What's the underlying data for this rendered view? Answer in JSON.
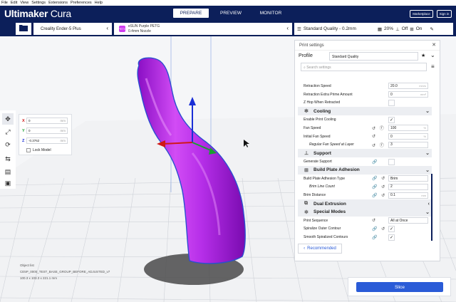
{
  "menu": [
    "File",
    "Edit",
    "View",
    "Settings",
    "Extensions",
    "Preferences",
    "Help"
  ],
  "app": {
    "brand": "Ultimaker",
    "brand_suffix": "Cura"
  },
  "stages": [
    "PREPARE",
    "PREVIEW",
    "MONITOR"
  ],
  "active_stage": "PREPARE",
  "header_buttons": {
    "marketplace": "Marketplace",
    "account": "Sign in"
  },
  "printer": {
    "name": "Creality Ender-5 Plus"
  },
  "material": {
    "swatch_label": "PETG",
    "name": "eSUN Purple PETG",
    "nozzle": "0.4mm Nozzle",
    "color": "#cf3cf0"
  },
  "summary": {
    "quality": "Standard Quality - 0.2mm",
    "infill": "20%",
    "support": "Off",
    "adhesion": "On"
  },
  "move_panel": {
    "x": {
      "label": "X",
      "value": "0",
      "unit": "mm"
    },
    "y": {
      "label": "Y",
      "value": "0",
      "unit": "mm"
    },
    "z": {
      "label": "Z",
      "value": "-0.3762",
      "unit": "mm"
    },
    "lock_model": "Lock Model"
  },
  "object_list": [
    "Object list",
    "CE5P_0000_TEST_BASE_GROUP_BEFORE_ADJUSTED_v7",
    "100.3 x 103.3 x 221.1 mm"
  ],
  "panel": {
    "title": "Print settings",
    "profile_label": "Profile",
    "profile_value": "Standard Quality",
    "search_placeholder": "Search settings",
    "rows": [
      {
        "kind": "field",
        "label": "Retraction Speed",
        "value": "20.0",
        "unit": "mm/s"
      },
      {
        "kind": "field",
        "label": "Retraction Extra Prime Amount",
        "value": "0",
        "unit": "mm³"
      },
      {
        "kind": "check",
        "label": "Z Hop When Retracted",
        "value": ""
      },
      {
        "kind": "category",
        "label": "Cooling",
        "icon": "✻",
        "chevron": "⌄"
      },
      {
        "kind": "check",
        "label": "Enable Print Cooling",
        "value": "✓"
      },
      {
        "kind": "field",
        "label": "Fan Speed",
        "value": "100",
        "unit": "%",
        "icons": "↺ ⓕ"
      },
      {
        "kind": "field",
        "label": "Initial Fan Speed",
        "value": "0",
        "unit": "%",
        "icons": "↺"
      },
      {
        "kind": "field",
        "label": "Regular Fan Speed at Layer",
        "value": "3",
        "unit": "",
        "icons": "↺ ⓕ",
        "indent": true
      },
      {
        "kind": "category",
        "label": "Support",
        "icon": "⊥",
        "chevron": "⌄"
      },
      {
        "kind": "check",
        "label": "Generate Support",
        "value": "",
        "icons": "🔗"
      },
      {
        "kind": "category",
        "label": "Build Plate Adhesion",
        "icon": "⊞",
        "chevron": "⌄"
      },
      {
        "kind": "field",
        "label": "Build Plate Adhesion Type",
        "value": "Brim",
        "unit": "",
        "icons": "🔗 ↺"
      },
      {
        "kind": "field",
        "label": "Brim Line Count",
        "value": "2",
        "unit": "",
        "icons": "🔗 ↺",
        "indent": true
      },
      {
        "kind": "field",
        "label": "Brim Distance",
        "value": "0.1",
        "unit": "mm",
        "icons": "🔗 ↺"
      },
      {
        "kind": "category",
        "label": "Dual Extrusion",
        "icon": "⧉",
        "chevron": "‹"
      },
      {
        "kind": "category",
        "label": "Special Modes",
        "icon": "✲",
        "chevron": "⌄"
      },
      {
        "kind": "field",
        "label": "Print Sequence",
        "value": "All at Once",
        "unit": "",
        "icons": "↺"
      },
      {
        "kind": "check",
        "label": "Spiralize Outer Contour",
        "value": "✓",
        "icons": "🔗 ↺"
      },
      {
        "kind": "check",
        "label": "Smooth Spiralized Contours",
        "value": "✓",
        "icons": "🔗"
      }
    ],
    "recommended": "Recommended"
  },
  "slice_button": "Slice"
}
